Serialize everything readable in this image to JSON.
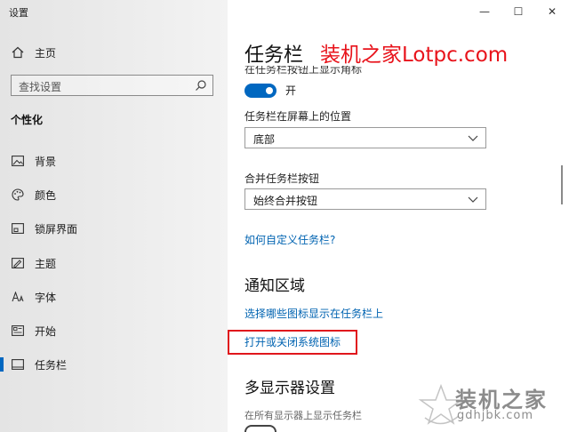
{
  "window": {
    "title": "设置",
    "controls": [
      "—",
      "☐",
      "✕"
    ]
  },
  "sidebar": {
    "home_label": "主页",
    "search_placeholder": "查找设置",
    "section_title": "个性化",
    "items": [
      {
        "label": "背景",
        "icon": "image-icon"
      },
      {
        "label": "颜色",
        "icon": "palette-icon"
      },
      {
        "label": "锁屏界面",
        "icon": "lockscreen-icon"
      },
      {
        "label": "主题",
        "icon": "theme-icon"
      },
      {
        "label": "字体",
        "icon": "font-icon"
      },
      {
        "label": "开始",
        "icon": "start-icon"
      },
      {
        "label": "任务栏",
        "icon": "taskbar-icon",
        "selected": true
      }
    ]
  },
  "content": {
    "title": "任务栏",
    "clipped_label": "在任务栏按钮上显示角标",
    "toggle_state": "开",
    "position_label": "任务栏在屏幕上的位置",
    "position_value": "底部",
    "combine_label": "合并任务栏按钮",
    "combine_value": "始终合并按钮",
    "customize_link": "如何自定义任务栏?",
    "notify_heading": "通知区域",
    "notify_link1": "选择哪些图标显示在任务栏上",
    "notify_link2": "打开或关闭系统图标",
    "multi_heading": "多显示器设置",
    "multi_label": "在所有显示器上显示任务栏"
  },
  "watermarks": {
    "top": "装机之家Lotpc.com",
    "bottom_name": "装机之家",
    "bottom_url": "gdhjbk.com"
  },
  "colors": {
    "accent": "#0067c0",
    "link": "#0063b1",
    "watermark_red": "#e8131b",
    "highlight": "#e0161c"
  }
}
